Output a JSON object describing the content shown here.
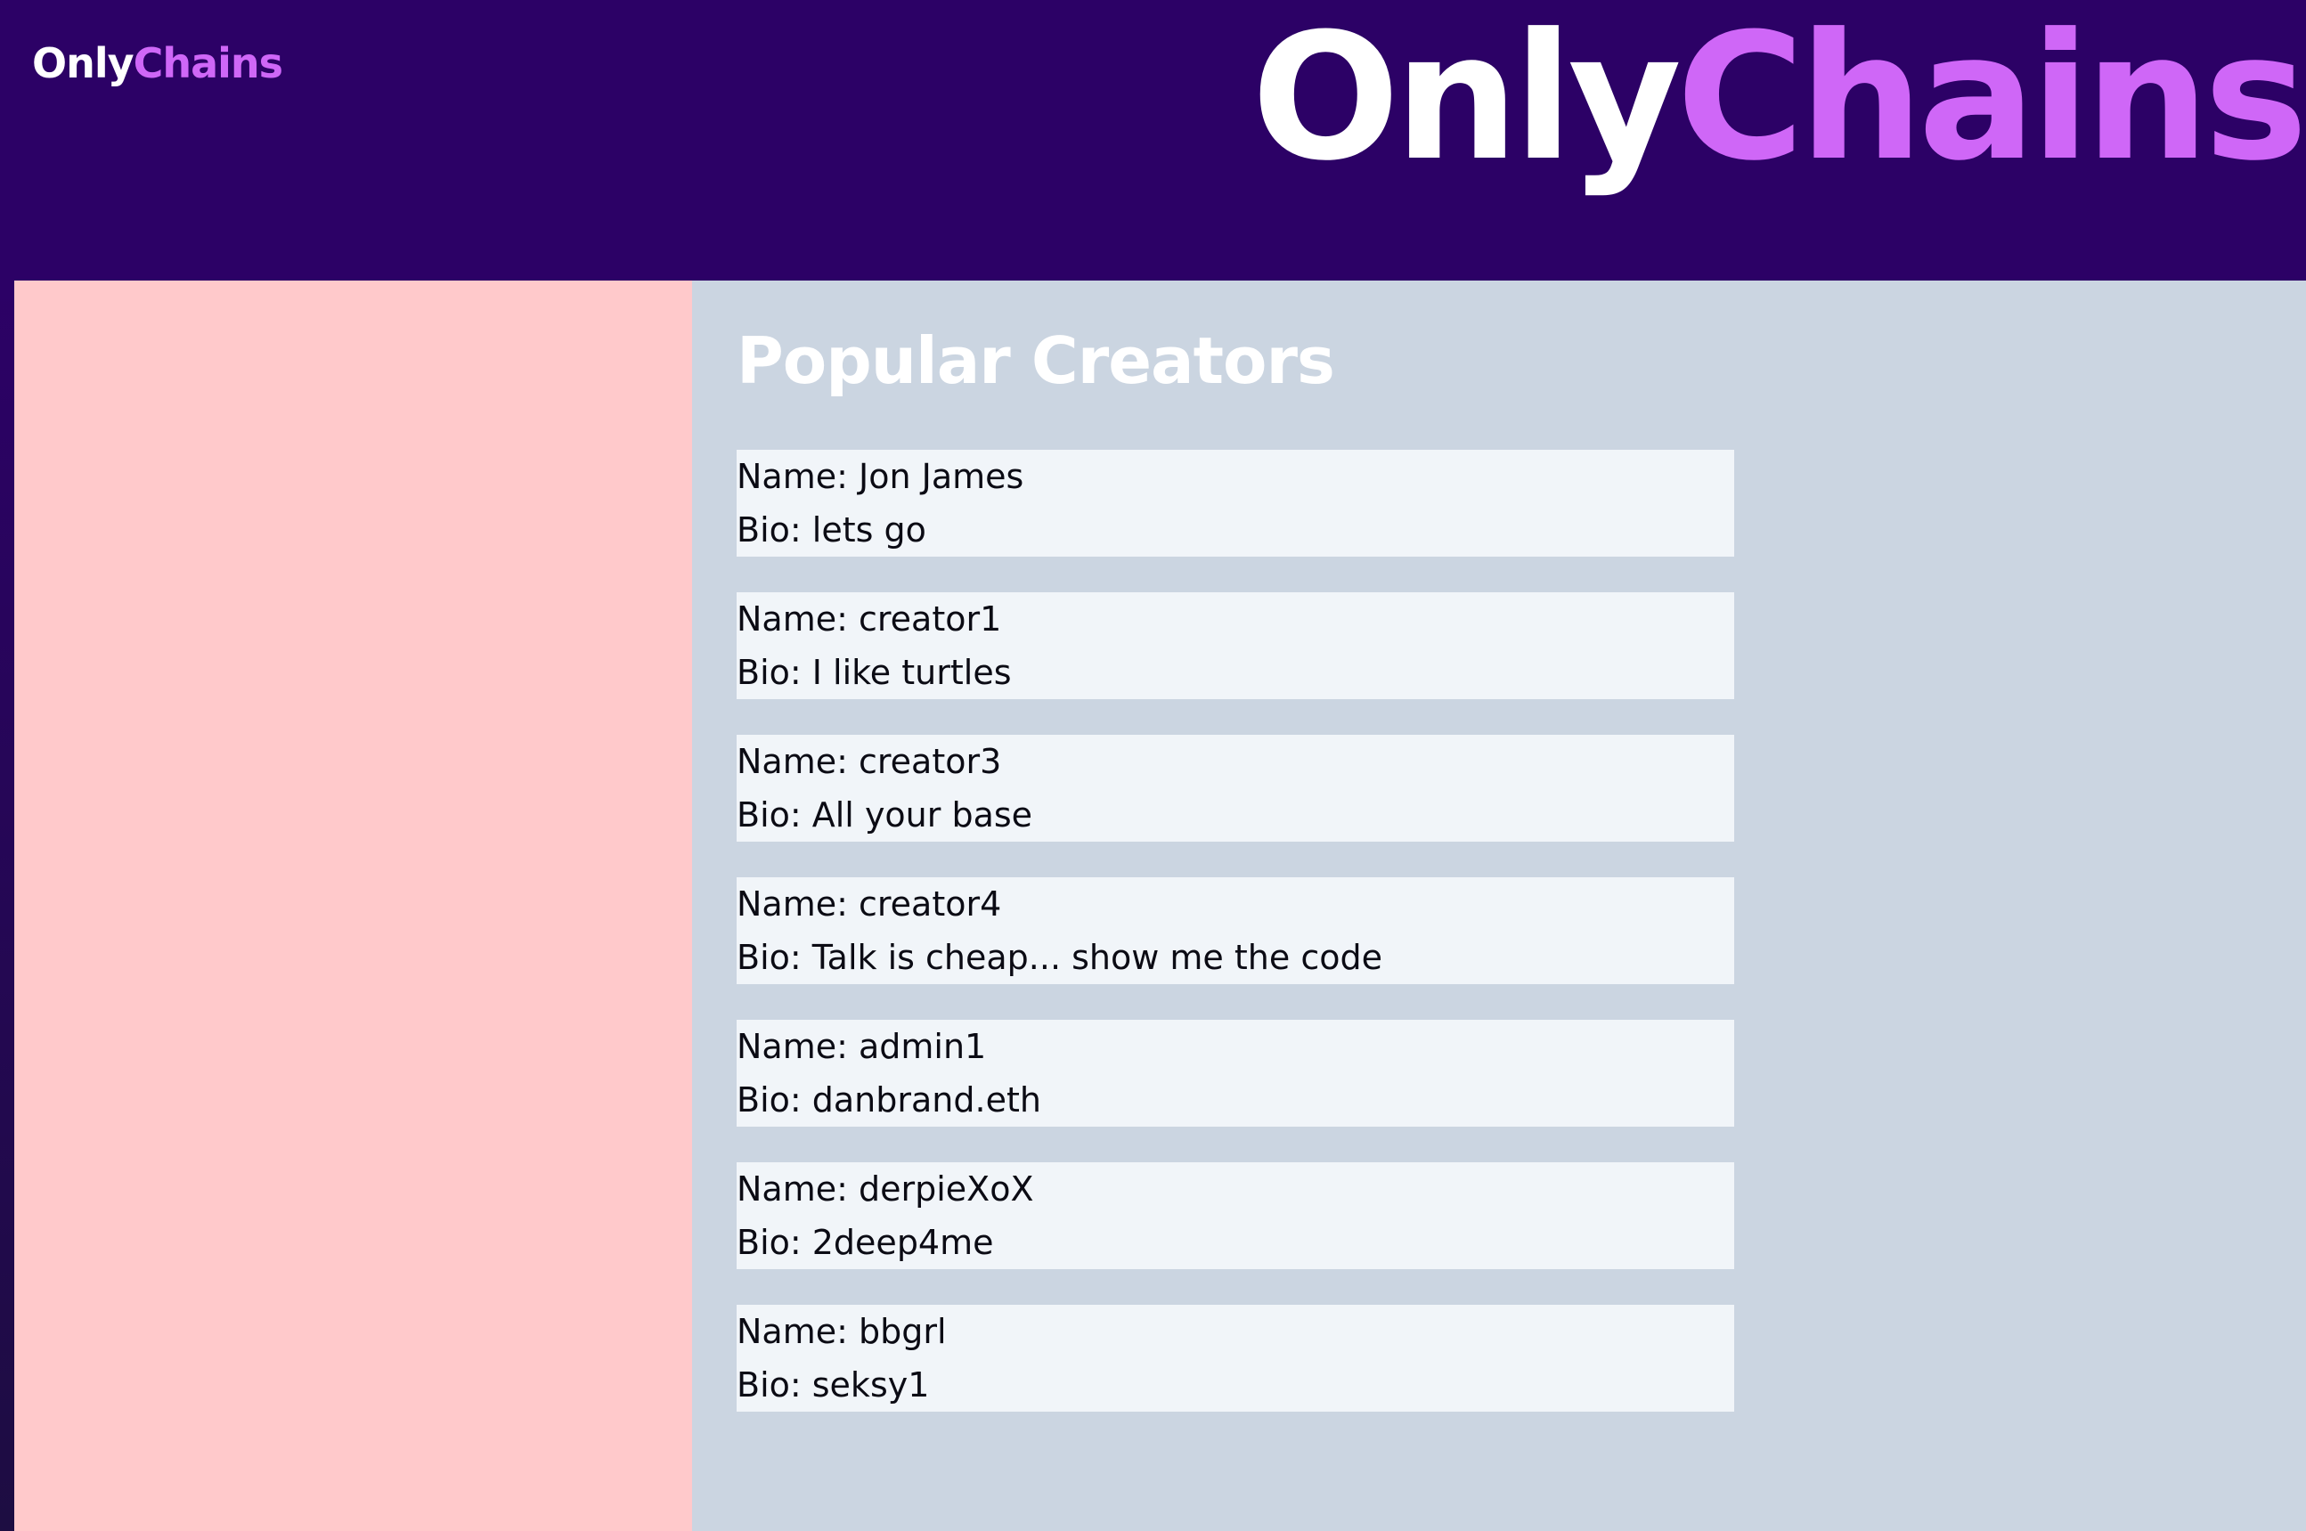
{
  "header": {
    "small_logo": {
      "only": "Only",
      "chains": "Chains"
    },
    "big_logo": {
      "only": "Only",
      "chains": "Chains"
    }
  },
  "main": {
    "title": "Popular Creators",
    "creators": [
      {
        "name": "Name: Jon James",
        "bio": "Bio: lets go"
      },
      {
        "name": "Name: creator1",
        "bio": "Bio: I like turtles"
      },
      {
        "name": "Name: creator3",
        "bio": "Bio: All your base"
      },
      {
        "name": "Name: creator4",
        "bio": "Bio: Talk is cheap... show me the code"
      },
      {
        "name": "Name: admin1",
        "bio": "Bio: danbrand.eth"
      },
      {
        "name": "Name: derpieXoX",
        "bio": "Bio: 2deep4me"
      },
      {
        "name": "Name: bbgrl",
        "bio": "Bio: seksy1"
      }
    ]
  },
  "colors": {
    "header_bg": "#2c0166",
    "brand_accent": "#cf67f7",
    "sidebar_bg": "#ffc9cb",
    "main_bg": "#cbd5e1",
    "card_bg": "#f1f5f9"
  }
}
